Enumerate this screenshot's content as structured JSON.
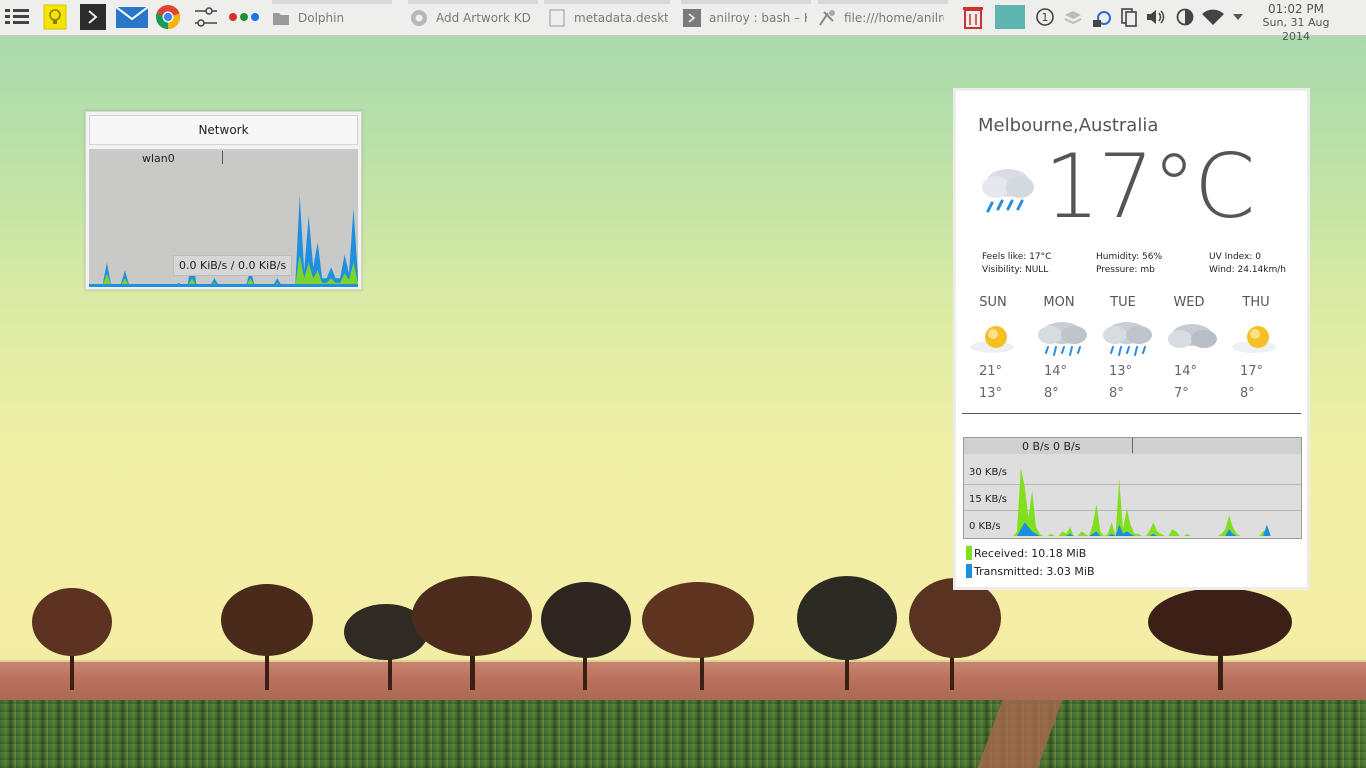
{
  "taskbar": {
    "launchers": [
      {
        "icon": "app-menu-icon"
      },
      {
        "icon": "knotes-icon"
      },
      {
        "icon": "terminal-icon"
      },
      {
        "icon": "mail-icon"
      },
      {
        "icon": "chrome-icon"
      },
      {
        "icon": "settings-sliders-icon"
      },
      {
        "icon": "color-dots-icon"
      }
    ],
    "tasks": [
      {
        "icon": "dolphin-icon",
        "label": "Dolphin"
      },
      {
        "icon": "chrome-task-icon",
        "label": "Add  Artwork KDE-L"
      },
      {
        "icon": "document-icon",
        "label": "metadata.desktop –"
      },
      {
        "icon": "konsole-icon",
        "label": "anilroy : bash – Kon"
      },
      {
        "icon": "browser-task-icon",
        "label": "file:///home/anilroy"
      }
    ],
    "tray": [
      "trash-icon",
      "window-thumb-icon",
      "activity-icon",
      "layers-icon",
      "network-manager-icon",
      "clipboard-icon",
      "volume-icon",
      "power-icon",
      "wifi-icon",
      "expand-arrow-icon"
    ],
    "clock": {
      "time": "01:02 PM",
      "date": "Sun, 31 Aug 2014"
    }
  },
  "network_widget": {
    "title": "Network",
    "interface": "wlan0",
    "rate": "0.0 KiB/s / 0.0 KiB/s",
    "chart_data": {
      "type": "area",
      "series": [
        {
          "color": "#1f8fe0",
          "values": [
            0,
            0,
            0,
            0,
            0.15,
            0,
            0,
            0,
            0.1,
            0,
            0,
            0,
            0,
            0,
            0,
            0,
            0,
            0,
            0,
            0,
            0.02,
            0,
            0,
            0.2,
            0,
            0,
            0,
            0,
            0.05,
            0,
            0,
            0,
            0,
            0,
            0,
            0,
            0.1,
            0,
            0,
            0,
            0,
            0,
            0.05,
            0,
            0,
            0,
            0,
            0.58,
            0.1,
            0.45,
            0.12,
            0.28,
            0.05,
            0.05,
            0.12,
            0.05,
            0.05,
            0.2,
            0.08,
            0.5,
            0.05
          ]
        },
        {
          "color": "#7bd32e",
          "values": [
            0,
            0,
            0,
            0,
            0.08,
            0,
            0,
            0,
            0.05,
            0,
            0,
            0,
            0,
            0,
            0,
            0,
            0,
            0,
            0,
            0,
            0.01,
            0,
            0,
            0.05,
            0,
            0,
            0,
            0,
            0.02,
            0,
            0,
            0,
            0,
            0,
            0,
            0,
            0.05,
            0,
            0,
            0,
            0,
            0,
            0.02,
            0,
            0,
            0,
            0,
            0.2,
            0.05,
            0.15,
            0.05,
            0.1,
            0.02,
            0.02,
            0.05,
            0.02,
            0.02,
            0.08,
            0.04,
            0.15,
            0.02
          ]
        }
      ]
    }
  },
  "weather": {
    "city": "Melbourne,Australia",
    "temp": "17°C",
    "current_icon": "rain-cloud-icon",
    "details": {
      "feels": "Feels like: 17°C",
      "visibility": "Visibility: NULL",
      "humidity": "Humidity: 56%",
      "pressure": "Pressure: mb",
      "uv": "UV Index: 0",
      "wind": "Wind: 24.14km/h"
    },
    "forecast": [
      {
        "day": "SUN",
        "icon": "sunny-icon",
        "hi": "21°",
        "lo": "13°"
      },
      {
        "day": "MON",
        "icon": "rain-icon",
        "hi": "14°",
        "lo": "8°"
      },
      {
        "day": "TUE",
        "icon": "rain-icon",
        "hi": "13°",
        "lo": "8°"
      },
      {
        "day": "WED",
        "icon": "cloudy-icon",
        "hi": "14°",
        "lo": "7°"
      },
      {
        "day": "THU",
        "icon": "sunny-icon",
        "hi": "17°",
        "lo": "8°"
      }
    ],
    "traffic": {
      "header": "0 B/s 0 B/s",
      "yticks": [
        "30 KB/s",
        "15 KB/s",
        "0 KB/s"
      ],
      "received": "Received: 10.18 MiB",
      "transmitted": "Transmitted: 3.03 MiB",
      "received_color": "#80e020",
      "transmitted_color": "#1a8fe0",
      "chart_data": {
        "type": "area",
        "ylim": [
          0,
          36
        ],
        "series": [
          {
            "name": "Received",
            "color": "#80e020",
            "values": [
              0,
              0,
              0,
              0,
              0,
              0,
              0,
              0,
              0,
              0,
              0,
              0,
              0,
              0,
              2,
              30,
              22,
              8,
              20,
              4,
              1,
              0,
              0,
              1,
              0,
              0,
              2,
              1,
              4,
              0,
              0,
              2,
              1,
              0,
              5,
              14,
              2,
              0,
              1,
              6,
              0,
              25,
              3,
              12,
              5,
              1,
              1,
              0,
              0,
              2,
              6,
              2,
              1,
              0,
              0,
              3,
              2,
              0,
              0,
              1,
              0,
              0,
              0,
              0,
              0,
              0,
              0,
              0,
              1,
              3,
              9,
              4,
              1,
              0,
              0,
              0,
              0,
              0,
              0,
              2,
              3,
              0,
              0,
              0,
              0,
              0,
              0,
              0,
              0,
              0
            ]
          },
          {
            "name": "Transmitted",
            "color": "#1a8fe0",
            "values": [
              0,
              0,
              0,
              0,
              0,
              0,
              0,
              0,
              0,
              0,
              0,
              0,
              0,
              0,
              0,
              3,
              6,
              4,
              2,
              1,
              0,
              0,
              0,
              0,
              0,
              0,
              0,
              0,
              1,
              0,
              0,
              0,
              0,
              0,
              1,
              2,
              0,
              0,
              0,
              1,
              0,
              5,
              1,
              2,
              1,
              0,
              0,
              0,
              0,
              0,
              1,
              0,
              0,
              0,
              0,
              0,
              0,
              0,
              0,
              0,
              0,
              0,
              0,
              0,
              0,
              0,
              0,
              0,
              0,
              0,
              3,
              1,
              0,
              0,
              0,
              0,
              0,
              0,
              0,
              0,
              5,
              0,
              0,
              0,
              0,
              0,
              0,
              0,
              0,
              0
            ]
          }
        ]
      }
    }
  }
}
